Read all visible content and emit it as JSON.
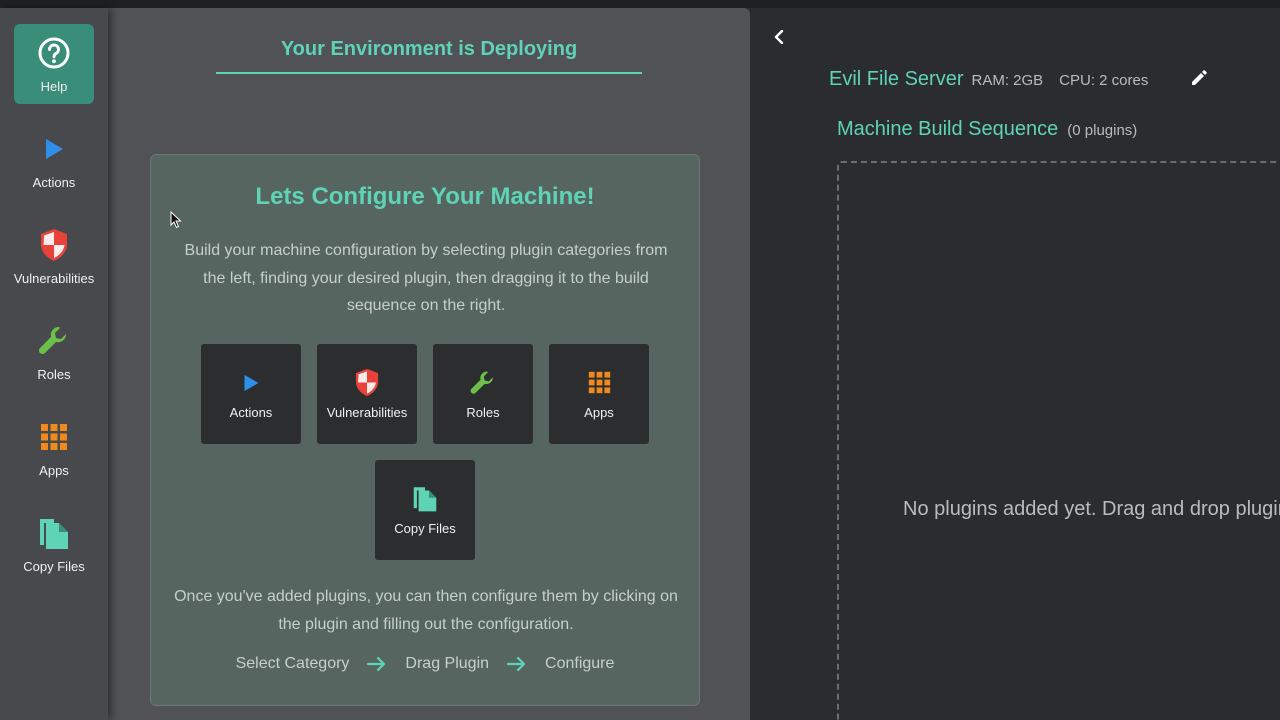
{
  "sidebar": {
    "items": [
      {
        "label": "Help",
        "icon": "help-circle-icon",
        "active": true
      },
      {
        "label": "Actions",
        "icon": "play-icon"
      },
      {
        "label": "Vulnerabilities",
        "icon": "shield-icon"
      },
      {
        "label": "Roles",
        "icon": "wrench-icon"
      },
      {
        "label": "Apps",
        "icon": "apps-grid-icon"
      },
      {
        "label": "Copy Files",
        "icon": "copy-files-icon"
      }
    ]
  },
  "left": {
    "deploy_title": "Your Environment is Deploying",
    "card": {
      "title": "Lets Configure Your Machine!",
      "description": "Build your machine configuration by selecting plugin categories from the left, finding your desired plugin, then dragging it to the build sequence on the right.",
      "tiles": [
        {
          "label": "Actions",
          "icon": "play-icon"
        },
        {
          "label": "Vulnerabilities",
          "icon": "shield-icon"
        },
        {
          "label": "Roles",
          "icon": "wrench-icon"
        },
        {
          "label": "Apps",
          "icon": "apps-grid-icon"
        },
        {
          "label": "Copy Files",
          "icon": "copy-files-icon"
        }
      ],
      "footer": "Once you've added plugins, you can then configure them by clicking on the plugin and filling out the configuration.",
      "steps": [
        "Select Category",
        "Drag Plugin",
        "Configure"
      ]
    }
  },
  "right": {
    "server_name": "Evil File Server",
    "ram": "RAM: 2GB",
    "cpu": "CPU: 2 cores",
    "sequence_title": "Machine Build Sequence",
    "sequence_count": "(0 plugins)",
    "empty_message": "No plugins added yet. Drag and drop plugins here"
  },
  "colors": {
    "accent": "#5fd3b6",
    "active_tab": "#3a8d78",
    "play": "#2f8fe8",
    "shield": "#e8433a",
    "wrench": "#6cc04a",
    "apps": "#f08a1c",
    "copy": "#5fd3b6"
  }
}
